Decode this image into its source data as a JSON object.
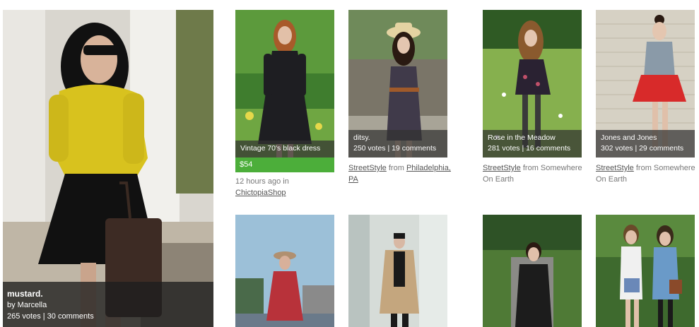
{
  "featured": {
    "title": "mustard.",
    "byline": "by Marcella",
    "stats": "265 votes | 30 comments"
  },
  "cards": [
    {
      "title": "Vintage 70's black dress",
      "price": "$54",
      "meta_time": "12 hours ago in",
      "meta_link": "ChictopiaShop"
    },
    {
      "title": "ditsy.",
      "stats": "250 votes | 19 comments",
      "meta_link": "StreetStyle",
      "meta_from": "from",
      "meta_place": "Philadelphia, PA"
    },
    {
      "title": "Rose in the Meadow",
      "stats": "281 votes | 16 comments",
      "meta_link": "StreetStyle",
      "meta_from": "from Somewhere On Earth"
    },
    {
      "title": "Jones and Jones",
      "stats": "302 votes | 29 comments",
      "meta_link": "StreetStyle",
      "meta_from": "from Somewhere On Earth"
    }
  ],
  "colors": {
    "price_green": "#4cae3a",
    "caption_bg": "#323232"
  }
}
